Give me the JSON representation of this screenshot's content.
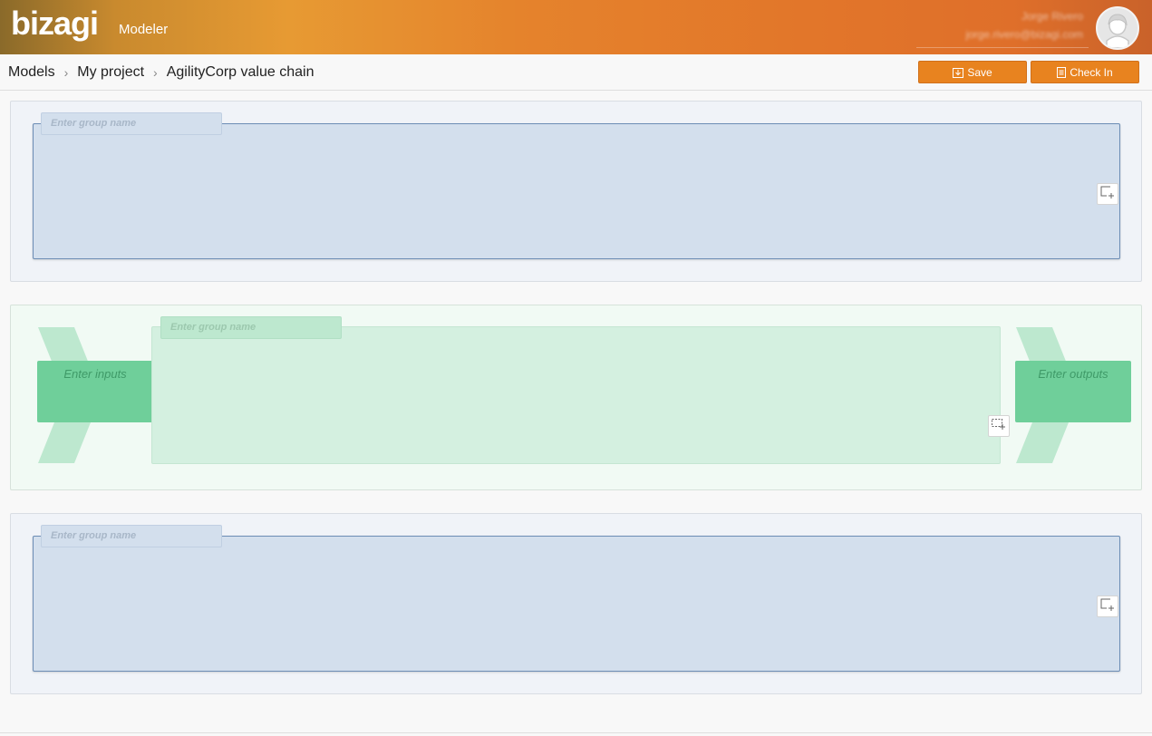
{
  "header": {
    "logo_text": "bizagi",
    "logo_sub": "Modeler",
    "user_name": "Jorge Rivero",
    "user_email": "jorge.rivero@bizagi.com"
  },
  "breadcrumb": {
    "items": [
      "Models",
      "My project",
      "AgilityCorp value chain"
    ]
  },
  "toolbar": {
    "save_label": "Save",
    "checkin_label": "Check In"
  },
  "panels": {
    "top": {
      "group_placeholder": "Enter group name"
    },
    "middle": {
      "group_placeholder": "Enter group name",
      "inputs_placeholder": "Enter inputs",
      "outputs_placeholder": "Enter outputs"
    },
    "bottom": {
      "group_placeholder": "Enter group name"
    }
  },
  "icons": {
    "save": "save-icon",
    "checkin": "checkin-icon",
    "add_group": "add-group-icon",
    "add_region": "add-region-icon",
    "avatar": "user-avatar-icon"
  },
  "colors": {
    "header_accent": "#e5832c",
    "button": "#e8831f",
    "support_group": "#d3dfed",
    "primary_group": "#d4f0e0",
    "io_box": "#6fcf9a"
  }
}
